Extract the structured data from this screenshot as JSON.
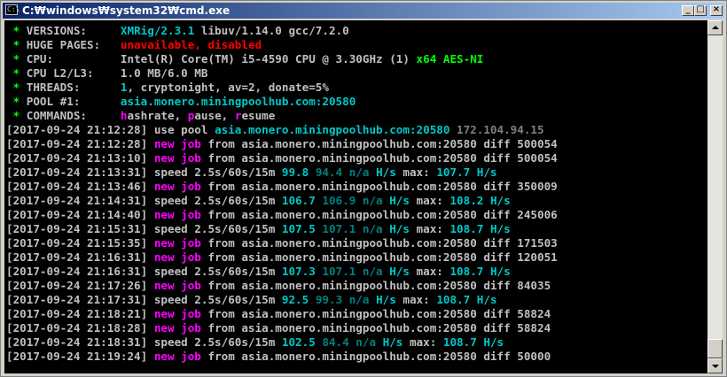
{
  "window": {
    "title": "C:₩windows₩system32₩cmd.exe",
    "icon_text": "C:\\"
  },
  "title_buttons": {
    "minimize": "_",
    "maximize": "□",
    "close": "×"
  },
  "colors": {
    "cyan": "#00c8c8",
    "magenta": "#ff00ff",
    "green": "#00ff00",
    "red": "#ff0000"
  },
  "console": {
    "header": [
      {
        "star": " * ",
        "label": "VERSIONS:     ",
        "parts": [
          [
            "XMRig/2.3.1",
            "cyan"
          ],
          [
            " libuv/1.14.0 gcc/7.2.0",
            "white"
          ]
        ]
      },
      {
        "star": " * ",
        "label": "HUGE PAGES:   ",
        "parts": [
          [
            "unavailable, disabled",
            "red"
          ]
        ]
      },
      {
        "star": " * ",
        "label": "CPU:          ",
        "parts": [
          [
            "Intel(R) Core(TM) i5-4590 CPU @ 3.30GHz (1) ",
            "white"
          ],
          [
            "x64 AES-NI",
            "green"
          ]
        ]
      },
      {
        "star": " * ",
        "label": "CPU L2/L3:    ",
        "parts": [
          [
            "1.0 MB/6.0 MB",
            "white"
          ]
        ]
      },
      {
        "star": " * ",
        "label": "THREADS:      ",
        "parts": [
          [
            "1",
            "cyan"
          ],
          [
            ", cryptonight, av=2, donate=5%",
            "white"
          ]
        ]
      },
      {
        "star": " * ",
        "label": "POOL #1:      ",
        "parts": [
          [
            "asia.monero.miningpoolhub.com:20580",
            "cyan"
          ]
        ]
      },
      {
        "star": " * ",
        "label": "COMMANDS:     ",
        "parts": [
          [
            "h",
            "mag"
          ],
          [
            "ashrate, ",
            "white"
          ],
          [
            "p",
            "mag"
          ],
          [
            "ause, ",
            "white"
          ],
          [
            "r",
            "mag"
          ],
          [
            "esume",
            "white"
          ]
        ]
      }
    ],
    "log": [
      {
        "ts": "[2017-09-24 21:12:28]",
        "parts": [
          [
            " use pool ",
            "white"
          ],
          [
            "asia.monero.miningpoolhub.com:20580",
            "cyan"
          ],
          [
            " 172.104.94.15",
            "grey"
          ]
        ]
      },
      {
        "ts": "[2017-09-24 21:12:28]",
        "parts": [
          [
            " new job",
            "mag"
          ],
          [
            " from asia.monero.miningpoolhub.com:20580 diff 500054",
            "white"
          ]
        ]
      },
      {
        "ts": "[2017-09-24 21:13:10]",
        "parts": [
          [
            " new job",
            "mag"
          ],
          [
            " from asia.monero.miningpoolhub.com:20580 diff 500054",
            "white"
          ]
        ]
      },
      {
        "ts": "[2017-09-24 21:13:31]",
        "parts": [
          [
            " speed 2.5s/60s/15m ",
            "white"
          ],
          [
            "99.8",
            "cyan"
          ],
          [
            " 94.4 n/a ",
            "teal"
          ],
          [
            "H/s",
            "cyan"
          ],
          [
            " max: ",
            "white"
          ],
          [
            "107.7 H/s",
            "cyan"
          ]
        ]
      },
      {
        "ts": "[2017-09-24 21:13:46]",
        "parts": [
          [
            " new job",
            "mag"
          ],
          [
            " from asia.monero.miningpoolhub.com:20580 diff 350009",
            "white"
          ]
        ]
      },
      {
        "ts": "[2017-09-24 21:14:31]",
        "parts": [
          [
            " speed 2.5s/60s/15m ",
            "white"
          ],
          [
            "106.7",
            "cyan"
          ],
          [
            " 106.9 n/a ",
            "teal"
          ],
          [
            "H/s",
            "cyan"
          ],
          [
            " max: ",
            "white"
          ],
          [
            "108.2 H/s",
            "cyan"
          ]
        ]
      },
      {
        "ts": "[2017-09-24 21:14:40]",
        "parts": [
          [
            " new job",
            "mag"
          ],
          [
            " from asia.monero.miningpoolhub.com:20580 diff 245006",
            "white"
          ]
        ]
      },
      {
        "ts": "[2017-09-24 21:15:31]",
        "parts": [
          [
            " speed 2.5s/60s/15m ",
            "white"
          ],
          [
            "107.5",
            "cyan"
          ],
          [
            " 107.1 n/a ",
            "teal"
          ],
          [
            "H/s",
            "cyan"
          ],
          [
            " max: ",
            "white"
          ],
          [
            "108.7 H/s",
            "cyan"
          ]
        ]
      },
      {
        "ts": "[2017-09-24 21:15:35]",
        "parts": [
          [
            " new job",
            "mag"
          ],
          [
            " from asia.monero.miningpoolhub.com:20580 diff 171503",
            "white"
          ]
        ]
      },
      {
        "ts": "[2017-09-24 21:16:31]",
        "parts": [
          [
            " new job",
            "mag"
          ],
          [
            " from asia.monero.miningpoolhub.com:20580 diff 120051",
            "white"
          ]
        ]
      },
      {
        "ts": "[2017-09-24 21:16:31]",
        "parts": [
          [
            " speed 2.5s/60s/15m ",
            "white"
          ],
          [
            "107.3",
            "cyan"
          ],
          [
            " 107.1 n/a ",
            "teal"
          ],
          [
            "H/s",
            "cyan"
          ],
          [
            " max: ",
            "white"
          ],
          [
            "108.7 H/s",
            "cyan"
          ]
        ]
      },
      {
        "ts": "[2017-09-24 21:17:26]",
        "parts": [
          [
            " new job",
            "mag"
          ],
          [
            " from asia.monero.miningpoolhub.com:20580 diff 84035",
            "white"
          ]
        ]
      },
      {
        "ts": "[2017-09-24 21:17:31]",
        "parts": [
          [
            " speed 2.5s/60s/15m ",
            "white"
          ],
          [
            "92.5",
            "cyan"
          ],
          [
            " 99.3 n/a ",
            "teal"
          ],
          [
            "H/s",
            "cyan"
          ],
          [
            " max: ",
            "white"
          ],
          [
            "108.7 H/s",
            "cyan"
          ]
        ]
      },
      {
        "ts": "[2017-09-24 21:18:21]",
        "parts": [
          [
            " new job",
            "mag"
          ],
          [
            " from asia.monero.miningpoolhub.com:20580 diff 58824",
            "white"
          ]
        ]
      },
      {
        "ts": "[2017-09-24 21:18:28]",
        "parts": [
          [
            " new job",
            "mag"
          ],
          [
            " from asia.monero.miningpoolhub.com:20580 diff 58824",
            "white"
          ]
        ]
      },
      {
        "ts": "[2017-09-24 21:18:31]",
        "parts": [
          [
            " speed 2.5s/60s/15m ",
            "white"
          ],
          [
            "102.5",
            "cyan"
          ],
          [
            " 84.4 n/a ",
            "teal"
          ],
          [
            "H/s",
            "cyan"
          ],
          [
            " max: ",
            "white"
          ],
          [
            "108.7 H/s",
            "cyan"
          ]
        ]
      },
      {
        "ts": "[2017-09-24 21:19:24]",
        "parts": [
          [
            " new job",
            "mag"
          ],
          [
            " from asia.monero.miningpoolhub.com:20580 diff 50000",
            "white"
          ]
        ]
      }
    ]
  }
}
